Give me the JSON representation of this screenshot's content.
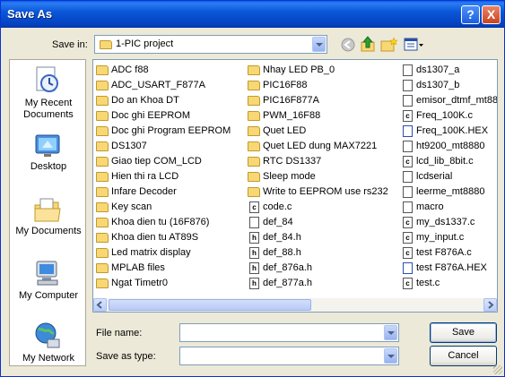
{
  "window": {
    "title": "Save As"
  },
  "savein": {
    "label": "Save in:",
    "value": "1-PIC project"
  },
  "places": [
    {
      "name": "place-my-recent-documents",
      "icon": "recent-documents-icon",
      "label1": "My Recent",
      "label2": "Documents"
    },
    {
      "name": "place-desktop",
      "icon": "desktop-icon",
      "label1": "Desktop",
      "label2": ""
    },
    {
      "name": "place-my-documents",
      "icon": "my-documents-icon",
      "label1": "My Documents",
      "label2": ""
    },
    {
      "name": "place-my-computer",
      "icon": "my-computer-icon",
      "label1": "My Computer",
      "label2": ""
    },
    {
      "name": "place-my-network",
      "icon": "my-network-icon",
      "label1": "My Network",
      "label2": ""
    }
  ],
  "columns": [
    [
      {
        "name": "ADC f88",
        "type": "folder"
      },
      {
        "name": "ADC_USART_F877A",
        "type": "folder"
      },
      {
        "name": "Do an Khoa DT",
        "type": "folder"
      },
      {
        "name": "Doc ghi EEPROM",
        "type": "folder"
      },
      {
        "name": "Doc ghi Program EEPROM",
        "type": "folder"
      },
      {
        "name": "DS1307",
        "type": "folder"
      },
      {
        "name": "Giao tiep COM_LCD",
        "type": "folder"
      },
      {
        "name": "Hien thi ra LCD",
        "type": "folder"
      },
      {
        "name": "Infare Decoder",
        "type": "folder"
      },
      {
        "name": "Key scan",
        "type": "folder"
      },
      {
        "name": "Khoa dien tu (16F876)",
        "type": "folder"
      },
      {
        "name": "Khoa dien tu AT89S",
        "type": "folder"
      },
      {
        "name": "Led matrix display",
        "type": "folder"
      },
      {
        "name": "MPLAB files",
        "type": "folder"
      },
      {
        "name": "Ngat Timetr0",
        "type": "folder"
      }
    ],
    [
      {
        "name": "Nhay LED PB_0",
        "type": "folder"
      },
      {
        "name": "PIC16F88",
        "type": "folder"
      },
      {
        "name": "PIC16F877A",
        "type": "folder"
      },
      {
        "name": "PWM_16F88",
        "type": "folder"
      },
      {
        "name": "Quet LED",
        "type": "folder"
      },
      {
        "name": "Quet LED dung MAX7221",
        "type": "folder"
      },
      {
        "name": "RTC DS1337",
        "type": "folder"
      },
      {
        "name": "Sleep mode",
        "type": "folder"
      },
      {
        "name": "Write to EEPROM use rs232",
        "type": "folder"
      },
      {
        "name": "code.c",
        "type": "c",
        "glyph": "c"
      },
      {
        "name": "def_84",
        "type": "text",
        "glyph": ""
      },
      {
        "name": "def_84.h",
        "type": "h",
        "glyph": "h"
      },
      {
        "name": "def_88.h",
        "type": "h",
        "glyph": "h"
      },
      {
        "name": "def_876a.h",
        "type": "h",
        "glyph": "h"
      },
      {
        "name": "def_877a.h",
        "type": "h",
        "glyph": "h"
      }
    ],
    [
      {
        "name": "ds1307_a",
        "type": "text",
        "glyph": ""
      },
      {
        "name": "ds1307_b",
        "type": "text",
        "glyph": ""
      },
      {
        "name": "emisor_dtmf_mt88",
        "type": "text",
        "glyph": ""
      },
      {
        "name": "Freq_100K.c",
        "type": "c",
        "glyph": "c"
      },
      {
        "name": "Freq_100K.HEX",
        "type": "hex",
        "glyph": ""
      },
      {
        "name": "ht9200_mt8880",
        "type": "text",
        "glyph": ""
      },
      {
        "name": "lcd_lib_8bit.c",
        "type": "c",
        "glyph": "c"
      },
      {
        "name": "lcdserial",
        "type": "text",
        "glyph": ""
      },
      {
        "name": "leerme_mt8880",
        "type": "text",
        "glyph": ""
      },
      {
        "name": "macro",
        "type": "text",
        "glyph": ""
      },
      {
        "name": "my_ds1337.c",
        "type": "c",
        "glyph": "c"
      },
      {
        "name": "my_input.c",
        "type": "c",
        "glyph": "c"
      },
      {
        "name": "test F876A.c",
        "type": "c",
        "glyph": "c"
      },
      {
        "name": "test F876A.HEX",
        "type": "hex",
        "glyph": ""
      },
      {
        "name": "test.c",
        "type": "c",
        "glyph": "c"
      }
    ]
  ],
  "filename": {
    "label": "File name:",
    "value": ""
  },
  "savetype": {
    "label": "Save as type:",
    "value": ""
  },
  "buttons": {
    "save": "Save",
    "cancel": "Cancel"
  },
  "titlebar_buttons": {
    "help": "?",
    "close": "X"
  }
}
